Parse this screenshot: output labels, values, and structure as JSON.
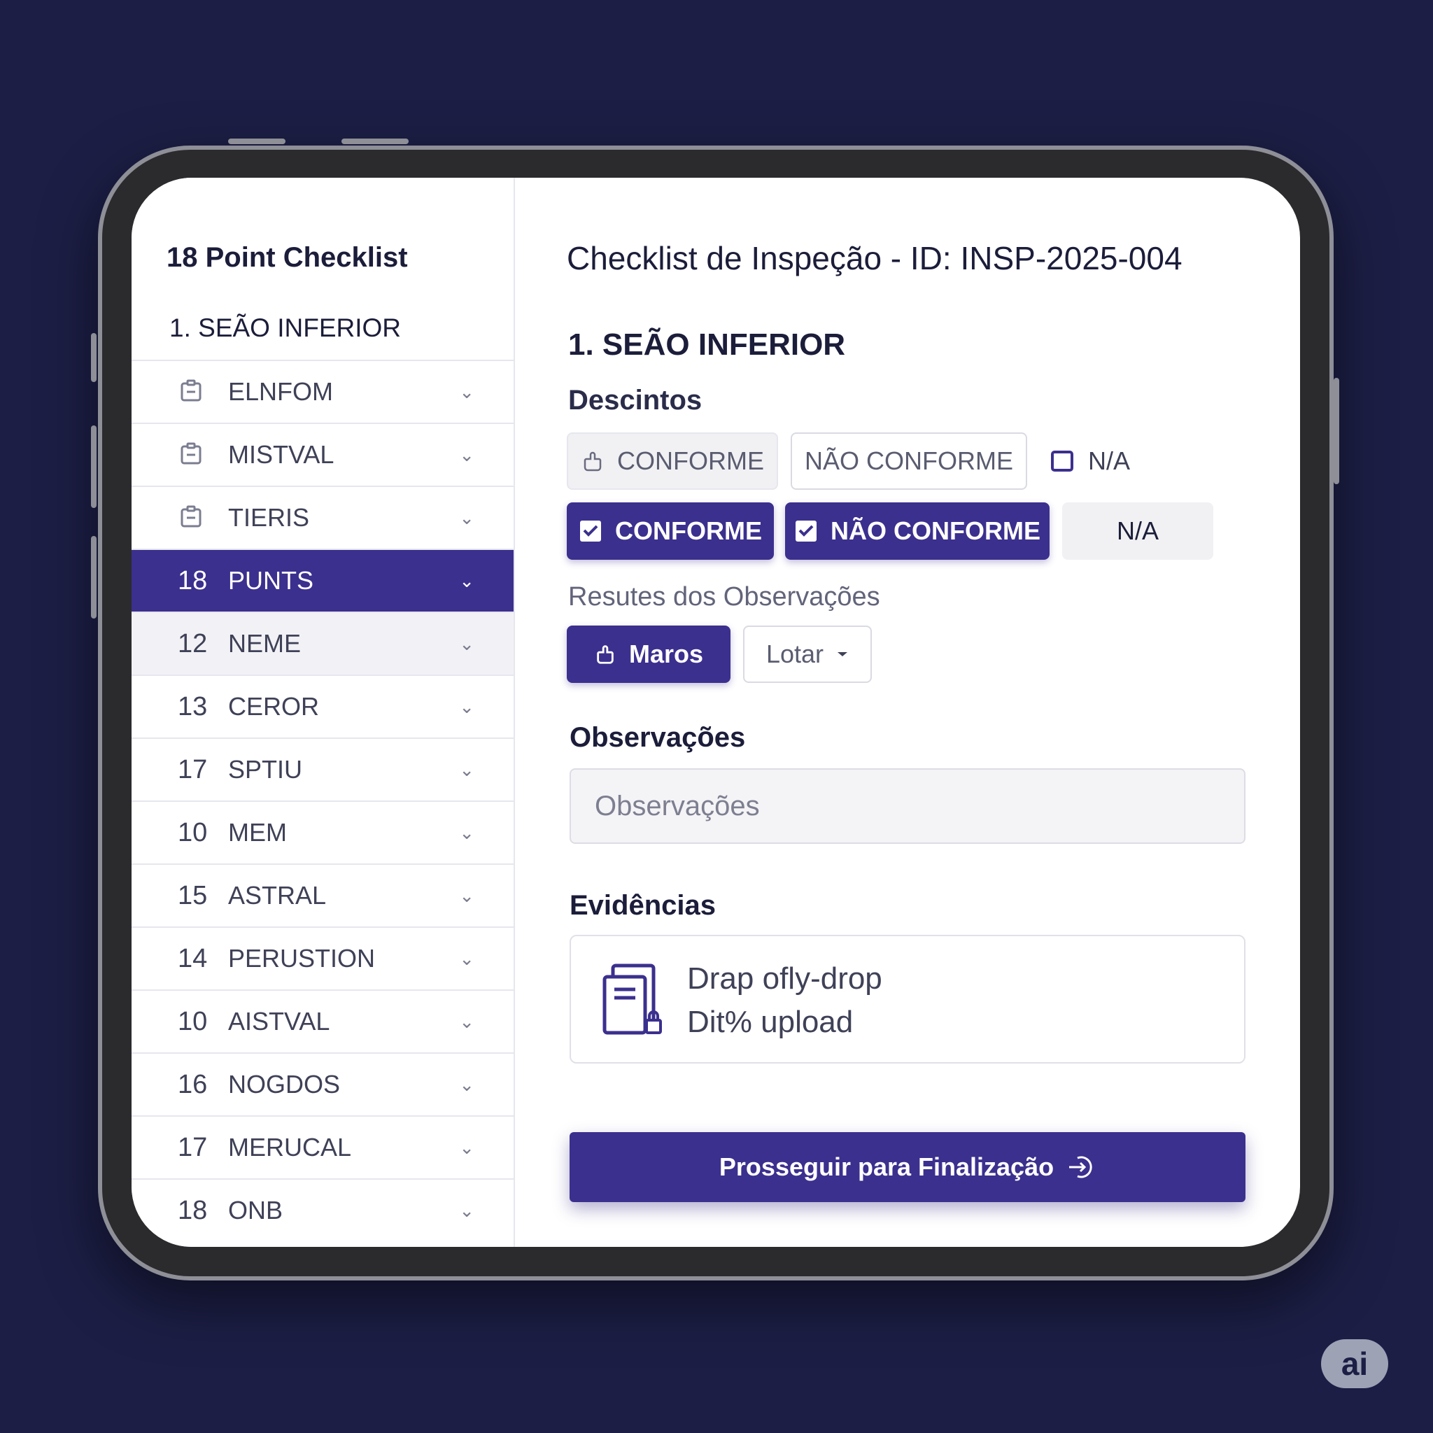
{
  "sidebar": {
    "title": "18 Point Checklist",
    "section": "1. SEÃO INFERIOR",
    "items": [
      {
        "num": "",
        "label": "ELNFOM",
        "icon": "clipboard-icon",
        "state": "normal"
      },
      {
        "num": "",
        "label": "MISTVAL",
        "icon": "clipboard-icon",
        "state": "normal"
      },
      {
        "num": "",
        "label": "TIERIS",
        "icon": "clipboard-icon",
        "state": "normal"
      },
      {
        "num": "18",
        "label": "PUNTS",
        "icon": "",
        "state": "active"
      },
      {
        "num": "12",
        "label": "NEME",
        "icon": "",
        "state": "hover"
      },
      {
        "num": "13",
        "label": "CEROR",
        "icon": "",
        "state": "normal"
      },
      {
        "num": "17",
        "label": "SPTIU",
        "icon": "",
        "state": "normal"
      },
      {
        "num": "10",
        "label": "MEM",
        "icon": "",
        "state": "normal"
      },
      {
        "num": "15",
        "label": "ASTRAL",
        "icon": "",
        "state": "normal"
      },
      {
        "num": "14",
        "label": "PERUSTION",
        "icon": "",
        "state": "normal"
      },
      {
        "num": "10",
        "label": "AISTVAL",
        "icon": "",
        "state": "normal"
      },
      {
        "num": "16",
        "label": "NOGDOS",
        "icon": "",
        "state": "normal"
      },
      {
        "num": "17",
        "label": "MERUCAL",
        "icon": "",
        "state": "normal"
      },
      {
        "num": "18",
        "label": "ONB",
        "icon": "",
        "state": "normal"
      }
    ]
  },
  "header": {
    "title": "Checklist de Inspeção - ID: INSP-2025-004",
    "menu_icon": "hamburger-menu-icon",
    "notification_color": "#ef4b45"
  },
  "main": {
    "section_title": "1. SEÃO INFERIOR",
    "subsection_title": "Descintos",
    "row1": {
      "conforme": "CONFORME",
      "nao_conforme": "NÃO CONFORME",
      "na": "N/A"
    },
    "row2": {
      "conforme": "CONFORME",
      "nao_conforme": "NÃO CONFORME",
      "na": "N/A"
    },
    "results_label": "Resutes dos Observações",
    "maros_button": "Maros",
    "lotar_select": "Lotar",
    "observacoes_title": "Observações",
    "observacoes_placeholder": "Observações",
    "evidencias_title": "Evidências",
    "dropzone_line1": "Drap ofly-drop",
    "dropzone_line2": "Dit% upload",
    "submit_label": "Prosseguir para Finalização"
  },
  "colors": {
    "primary": "#3b308e",
    "background": "#1c1e45"
  },
  "badge": "ai"
}
